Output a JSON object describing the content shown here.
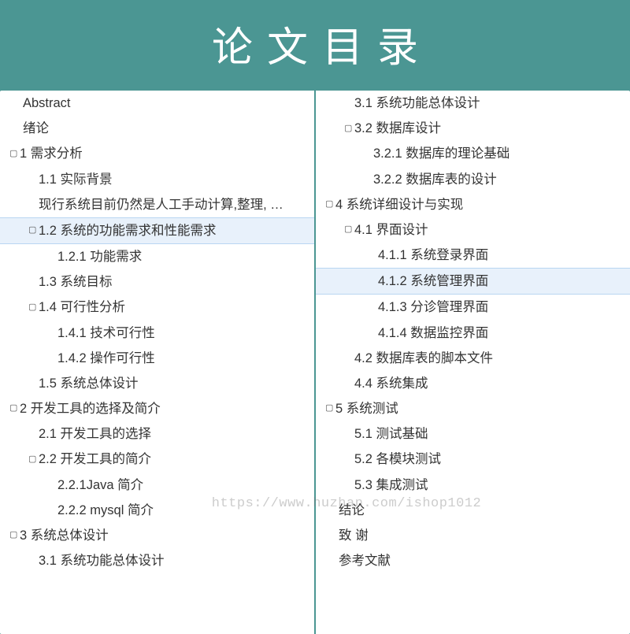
{
  "header": {
    "title": "论文目录"
  },
  "left": [
    {
      "lv": 0,
      "caret": "",
      "text": "Abstract",
      "sel": false
    },
    {
      "lv": 0,
      "caret": "",
      "text": "绪论",
      "sel": false
    },
    {
      "lv": 1,
      "caret": "▢",
      "text": "1    需求分析",
      "sel": false
    },
    {
      "lv": 2,
      "caret": "",
      "text": "1.1 实际背景",
      "sel": false
    },
    {
      "lv": 2,
      "caret": "",
      "text": "现行系统目前仍然是人工手动计算,整理, …",
      "sel": false
    },
    {
      "lv": 2,
      "caret": "▢",
      "text": "1.2 系统的功能需求和性能需求",
      "sel": true
    },
    {
      "lv": 3,
      "caret": "",
      "text": "1.2.1 功能需求",
      "sel": false
    },
    {
      "lv": 2,
      "caret": "",
      "text": "1.3 系统目标",
      "sel": false
    },
    {
      "lv": 2,
      "caret": "▢",
      "text": "1.4 可行性分析",
      "sel": false
    },
    {
      "lv": 3,
      "caret": "",
      "text": "1.4.1 技术可行性",
      "sel": false
    },
    {
      "lv": 3,
      "caret": "",
      "text": "1.4.2 操作可行性",
      "sel": false
    },
    {
      "lv": 2,
      "caret": "",
      "text": "1.5 系统总体设计",
      "sel": false
    },
    {
      "lv": 1,
      "caret": "▢",
      "text": "2    开发工具的选择及简介",
      "sel": false
    },
    {
      "lv": 2,
      "caret": "",
      "text": "2.1 开发工具的选择",
      "sel": false
    },
    {
      "lv": 2,
      "caret": "▢",
      "text": "2.2 开发工具的简介",
      "sel": false
    },
    {
      "lv": 3,
      "caret": "",
      "text": "2.2.1Java 简介",
      "sel": false
    },
    {
      "lv": 3,
      "caret": "",
      "text": "2.2.2 mysql 简介",
      "sel": false
    },
    {
      "lv": 1,
      "caret": "▢",
      "text": "3 系统总体设计",
      "sel": false
    },
    {
      "lv": 2,
      "caret": "",
      "text": "3.1 系统功能总体设计",
      "sel": false
    }
  ],
  "right": [
    {
      "lv": 2,
      "caret": "",
      "text": "3.1 系统功能总体设计",
      "sel": false
    },
    {
      "lv": 2,
      "caret": "▢",
      "text": "3.2 数据库设计",
      "sel": false
    },
    {
      "lv": 3,
      "caret": "",
      "text": "3.2.1 数据库的理论基础",
      "sel": false
    },
    {
      "lv": 3,
      "caret": "",
      "text": "3.2.2 数据库表的设计",
      "sel": false
    },
    {
      "lv": 1,
      "caret": "▢",
      "text": "4 系统详细设计与实现",
      "sel": false
    },
    {
      "lv": 2,
      "caret": "▢",
      "text": "4.1 界面设计",
      "sel": false
    },
    {
      "lv": 4,
      "caret": "",
      "text": "4.1.1 系统登录界面",
      "sel": false
    },
    {
      "lv": 4,
      "caret": "",
      "text": "4.1.2 系统管理界面",
      "sel": true
    },
    {
      "lv": 4,
      "caret": "",
      "text": "4.1.3 分诊管理界面",
      "sel": false
    },
    {
      "lv": 4,
      "caret": "",
      "text": "4.1.4 数据监控界面",
      "sel": false
    },
    {
      "lv": 2,
      "caret": "",
      "text": "4.2 数据库表的脚本文件",
      "sel": false
    },
    {
      "lv": 2,
      "caret": "",
      "text": "4.4 系统集成",
      "sel": false
    },
    {
      "lv": 1,
      "caret": "▢",
      "text": "5     系统测试",
      "sel": false
    },
    {
      "lv": 2,
      "caret": "",
      "text": "5.1 测试基础",
      "sel": false
    },
    {
      "lv": 2,
      "caret": "",
      "text": "5.2 各模块测试",
      "sel": false
    },
    {
      "lv": 2,
      "caret": "",
      "text": "5.3 集成测试",
      "sel": false
    },
    {
      "lv": 0,
      "caret": "",
      "text": "结论",
      "sel": false
    },
    {
      "lv": 0,
      "caret": "",
      "text": "致    谢",
      "sel": false
    },
    {
      "lv": 0,
      "caret": "",
      "text": "参考文献",
      "sel": false
    }
  ],
  "watermark": "https://www.huzhan.com/ishop1012"
}
